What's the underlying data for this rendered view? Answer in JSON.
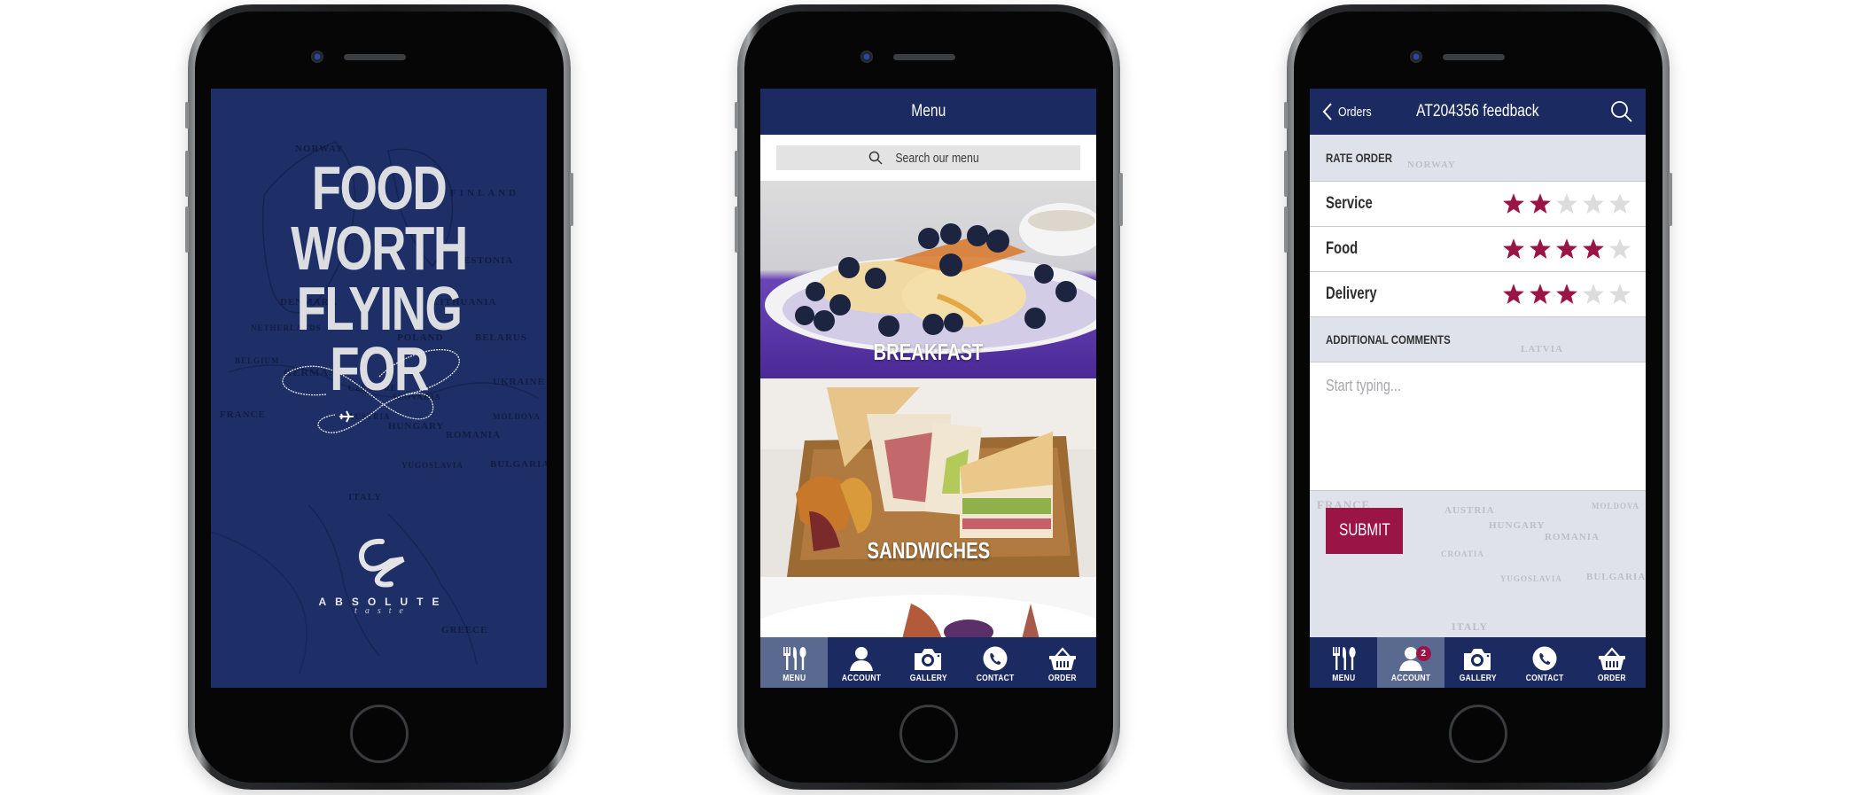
{
  "colors": {
    "navy": "#1b2b61",
    "tab_active": "#5a6990",
    "accent_crimson": "#9b1446",
    "star_empty": "#dcdcdc",
    "splash_bg": "#1d2f66"
  },
  "splash": {
    "headline": [
      "FOOD",
      "WORTH",
      "FLYING",
      "FOR"
    ],
    "logo_brand": "ABSOLUTE",
    "logo_sub": "taste",
    "map_labels": [
      "NORWAY",
      "FINLAND",
      "ESTONIA",
      "LITHUANIA",
      "DENMARK",
      "NETHERLANDS",
      "POLAND",
      "BELARUS",
      "BELGIUM",
      "GERMANY",
      "CZECH REP.",
      "SLOVAKIA",
      "UKRAINE",
      "FRANCE",
      "AUSTRIA",
      "MOLDOVA",
      "HUNGARY",
      "ROMANIA",
      "YUGOSLAVIA",
      "BULGARIA",
      "ITALY",
      "GREECE"
    ]
  },
  "menu_screen": {
    "header_title": "Menu",
    "search_placeholder": "Search our menu",
    "categories": [
      {
        "label": "BREAKFAST"
      },
      {
        "label": "SANDWICHES"
      }
    ]
  },
  "tabbar": {
    "items": [
      {
        "label": "MENU",
        "icon": "cutlery-icon"
      },
      {
        "label": "ACCOUNT",
        "icon": "user-icon"
      },
      {
        "label": "GALLERY",
        "icon": "camera-icon"
      },
      {
        "label": "CONTACT",
        "icon": "phone-icon"
      },
      {
        "label": "ORDER",
        "icon": "basket-icon"
      }
    ]
  },
  "feedback_screen": {
    "back_label": "Orders",
    "header_title": "AT204356 feedback",
    "rate_section": "RATE ORDER",
    "ratings": [
      {
        "label": "Service",
        "value": 2,
        "max": 5
      },
      {
        "label": "Food",
        "value": 4,
        "max": 5
      },
      {
        "label": "Delivery",
        "value": 3,
        "max": 5
      }
    ],
    "comments_section": "ADDITIONAL COMMENTS",
    "comments_placeholder": "Start typing...",
    "submit_label": "SUBMIT",
    "account_badge": "2",
    "map_labels": [
      "NORWAY",
      "LATVIA",
      "FRANCE",
      "AUSTRIA",
      "HUNGARY",
      "ROMANIA",
      "MOLDOVA",
      "CROATIA",
      "YUGOSLAVIA",
      "BULGARIA",
      "ITALY"
    ]
  }
}
